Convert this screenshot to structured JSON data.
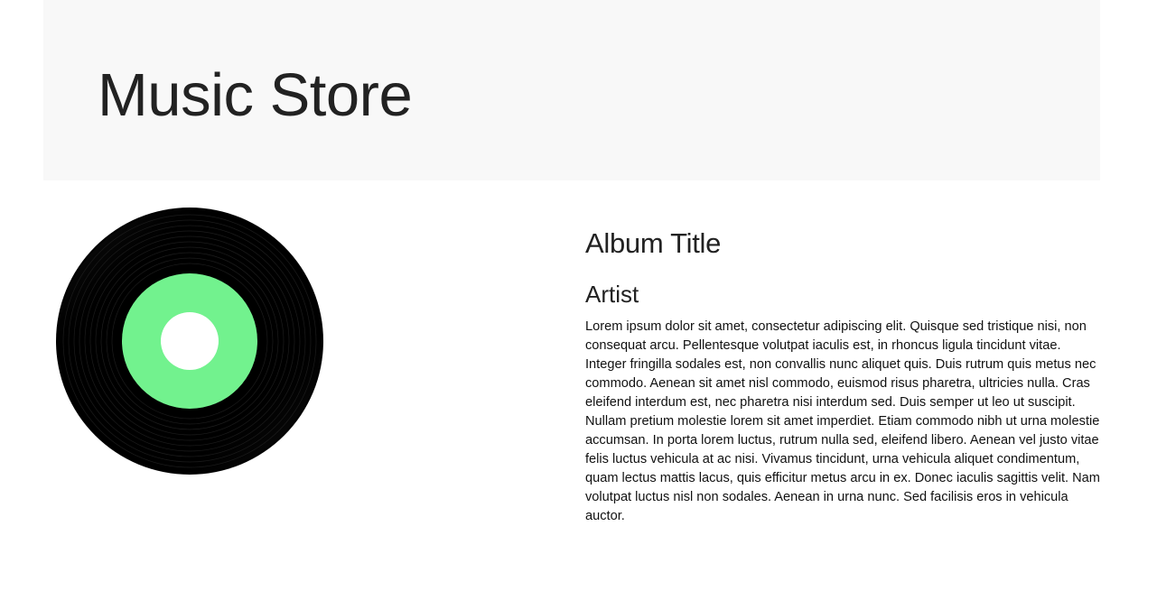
{
  "header": {
    "title": "Music Store"
  },
  "album": {
    "image": {
      "icon": "vinyl-record-icon",
      "label_color": "#72f28e",
      "disc_color": "#000000",
      "hole_color": "#ffffff"
    },
    "title": "Album Title",
    "artist": "Artist",
    "description": "Lorem ipsum dolor sit amet, consectetur adipiscing elit. Quisque sed tristique nisi, non consequat arcu. Pellentesque volutpat iaculis est, in rhoncus ligula tincidunt vitae. Integer fringilla sodales est, non convallis nunc aliquet quis. Duis rutrum quis metus nec commodo. Aenean sit amet nisl commodo, euismod risus pharetra, ultricies nulla. Cras eleifend interdum est, nec pharetra nisi interdum sed. Duis semper ut leo ut suscipit. Nullam pretium molestie lorem sit amet imperdiet. Etiam commodo nibh ut urna molestie accumsan. In porta lorem luctus, rutrum nulla sed, eleifend libero. Aenean vel justo vitae felis luctus vehicula at ac nisi. Vivamus tincidunt, urna vehicula aliquet condimentum, quam lectus mattis lacus, quis efficitur metus arcu in ex. Donec iaculis sagittis velit. Nam volutpat luctus nisl non sodales. Aenean in urna nunc. Sed facilisis eros in vehicula auctor."
  }
}
